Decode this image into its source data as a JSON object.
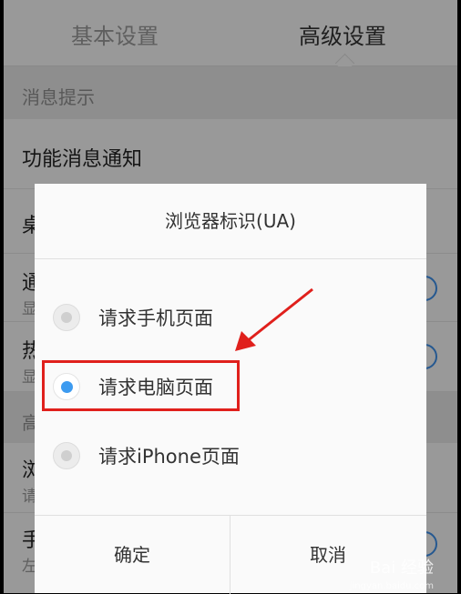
{
  "tabs": {
    "basic": "基本设置",
    "advanced": "高级设置"
  },
  "settings": {
    "section1_header": "消息提示",
    "function_notify": "功能消息通知",
    "row2_title": "桌",
    "row3_title": "通",
    "row3_sub": "显",
    "row4_title": "热",
    "row4_sub": "显",
    "section2_header": "高",
    "row5_title": "浏",
    "row5_sub": "请",
    "row6_title": "手",
    "row6_sub": "左"
  },
  "dialog": {
    "title": "浏览器标识(UA)",
    "options": [
      {
        "label": "请求手机页面",
        "selected": false
      },
      {
        "label": "请求电脑页面",
        "selected": true
      },
      {
        "label": "请求iPhone页面",
        "selected": false
      }
    ],
    "ok": "确定",
    "cancel": "取消"
  },
  "watermark": {
    "text": "Bai 经验",
    "sub": "jingyan.baidu.com"
  },
  "colors": {
    "accent": "#3d9bf0",
    "highlight": "#e0201c"
  }
}
